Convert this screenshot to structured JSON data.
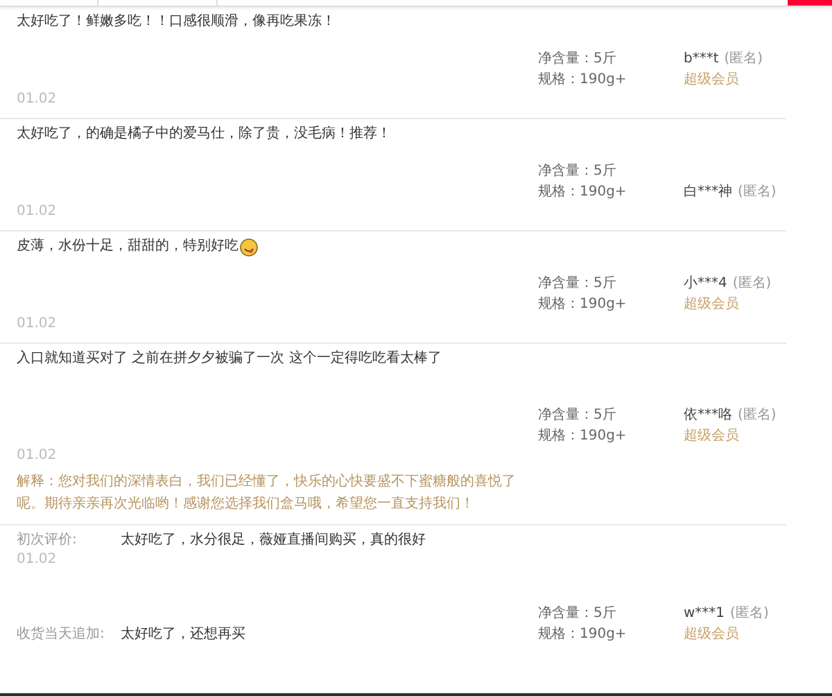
{
  "reviews": [
    {
      "kind": "plain",
      "text": "太好吃了！鲜嫩多吃！！口感很顺滑，像再吃果冻！",
      "date": "01.02",
      "specs": [
        "净含量：5斤",
        "规格：190g+"
      ],
      "user": "b***t",
      "anon": "(匿名)",
      "badge": "超级会员"
    },
    {
      "kind": "plain",
      "text": "太好吃了，的确是橘子中的爱马仕，除了贵，没毛病！推荐！",
      "date": "01.02",
      "specs": [
        "净含量：5斤",
        "规格：190g+"
      ],
      "user": "白***神",
      "anon": "(匿名)"
    },
    {
      "kind": "plain",
      "text": "皮薄，水份十足，甜甜的，特别好吃",
      "emoji": true,
      "date": "01.02",
      "specs": [
        "净含量：5斤",
        "规格：190g+"
      ],
      "user": "小***4",
      "anon": "(匿名)",
      "badge": "超级会员"
    },
    {
      "kind": "plain",
      "text": "入口就知道买对了 之前在拼夕夕被骗了一次 这个一定得吃吃看太棒了",
      "date": "01.02",
      "specs": [
        "净含量：5斤",
        "规格：190g+"
      ],
      "user": "依***咯",
      "anon": "(匿名)",
      "badge": "超级会员",
      "reply": "解释：您对我们的深情表白，我们已经懂了，快乐的心快要盛不下蜜糖般的喜悦了呢。期待亲亲再次光临哟！感谢您选择我们盒马哦，希望您一直支持我们！"
    },
    {
      "kind": "followup",
      "label": "初次评价:",
      "text": "太好吃了，水分很足，薇娅直播间购买，真的很好",
      "date": "01.02",
      "specs": [
        "净含量：5斤",
        "规格：190g+"
      ],
      "user": "w***1",
      "anon": "(匿名)",
      "badge": "超级会员",
      "followup_label": "收货当天追加:",
      "followup_text": "太好吃了，还想再买"
    }
  ]
}
